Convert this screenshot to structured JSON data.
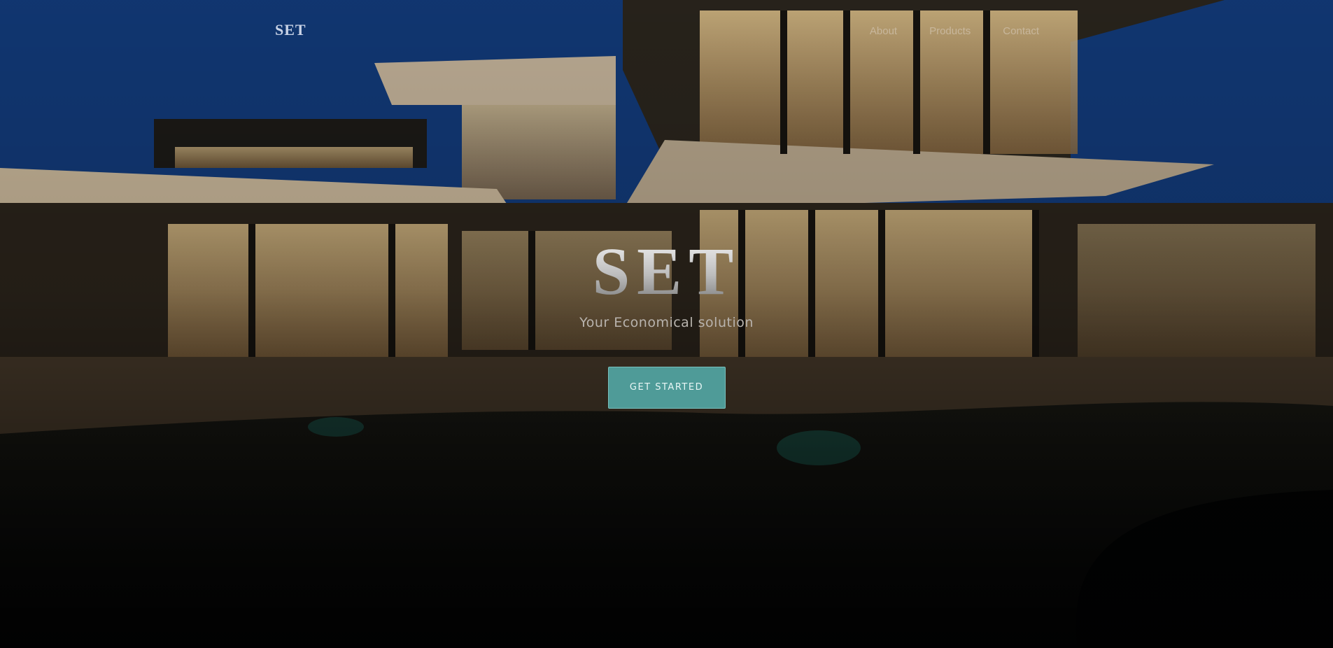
{
  "nav": {
    "logo": "SET",
    "links": [
      "About",
      "Products",
      "Contact"
    ]
  },
  "hero": {
    "title": "SET",
    "subtitle": "Your Economical solution",
    "cta_label": "GET STARTED"
  },
  "colors": {
    "accent": "#4f9b98",
    "nav_link": "#c8b79c",
    "logo": "#c9d3e6",
    "subtitle": "#b8b3ad"
  }
}
